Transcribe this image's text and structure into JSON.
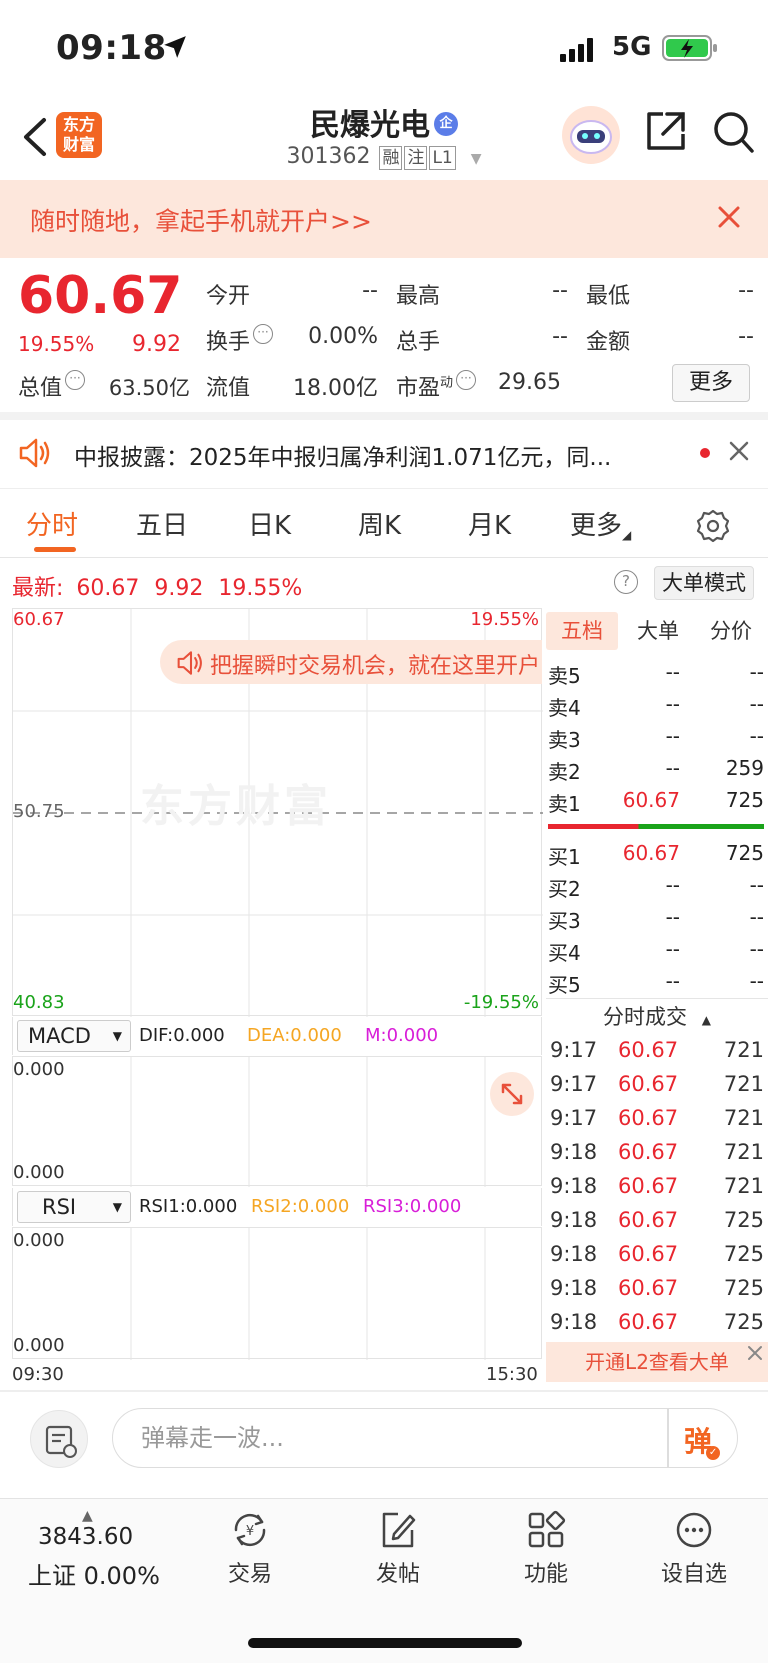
{
  "status_bar": {
    "time": "09:18",
    "network": "5G"
  },
  "header": {
    "logo_line1": "东方",
    "logo_line2": "财富",
    "stock_name": "民爆光电",
    "badge": "企",
    "stock_code": "301362",
    "tags": [
      "融",
      "注",
      "L1"
    ]
  },
  "banner": {
    "text": "随时随地，拿起手机就开户>>"
  },
  "quote": {
    "price": "60.67",
    "pct": "19.55%",
    "change": "9.92",
    "fields": [
      {
        "label": "今开",
        "value": "--"
      },
      {
        "label": "最高",
        "value": "--"
      },
      {
        "label": "最低",
        "value": "--"
      },
      {
        "label": "换手",
        "value": "0.00%"
      },
      {
        "label": "总手",
        "value": "--"
      },
      {
        "label": "金额",
        "value": "--"
      },
      {
        "label": "总值",
        "value": "63.50亿"
      },
      {
        "label": "流值",
        "value": "18.00亿"
      },
      {
        "label": "市盈",
        "sup": "动",
        "value": "29.65"
      }
    ],
    "more": "更多"
  },
  "notice": {
    "text": "中报披露：2025年中报归属净利润1.071亿元，同..."
  },
  "tabs": [
    "分时",
    "五日",
    "日K",
    "周K",
    "月K",
    "更多"
  ],
  "latest": {
    "label": "最新:",
    "price": "60.67",
    "change": "9.92",
    "pct": "19.55%"
  },
  "big_order_mode": "大单模式",
  "chart": {
    "price_high": "60.67",
    "pct_high": "19.55%",
    "price_mid": "50.75",
    "price_low": "40.83",
    "pct_low": "-19.55%",
    "watermark": "东方财富",
    "tip": "把握瞬时交易机会，就在这里开户",
    "time_start": "09:30",
    "time_end": "15:30"
  },
  "macd": {
    "name": "MACD",
    "dif": "DIF:0.000",
    "dea": "DEA:0.000",
    "m": "M:0.000",
    "top": "0.000",
    "bottom": "0.000",
    "colors": {
      "dif": "#222222",
      "dea": "#f5a623",
      "m": "#d81ed8"
    }
  },
  "rsi": {
    "name": "RSI",
    "rsi1": "RSI1:0.000",
    "rsi2": "RSI2:0.000",
    "rsi3": "RSI3:0.000",
    "top": "0.000",
    "bottom": "0.000"
  },
  "side_tabs": [
    "五档",
    "大单",
    "分价"
  ],
  "order_book": {
    "asks": [
      {
        "label": "卖5",
        "price": "--",
        "vol": "--"
      },
      {
        "label": "卖4",
        "price": "--",
        "vol": "--"
      },
      {
        "label": "卖3",
        "price": "--",
        "vol": "--"
      },
      {
        "label": "卖2",
        "price": "--",
        "vol": "259"
      },
      {
        "label": "卖1",
        "price": "60.67",
        "vol": "725"
      }
    ],
    "bids": [
      {
        "label": "买1",
        "price": "60.67",
        "vol": "725"
      },
      {
        "label": "买2",
        "price": "--",
        "vol": "--"
      },
      {
        "label": "买3",
        "price": "--",
        "vol": "--"
      },
      {
        "label": "买4",
        "price": "--",
        "vol": "--"
      },
      {
        "label": "买5",
        "price": "--",
        "vol": "--"
      }
    ]
  },
  "trades": {
    "title": "分时成交",
    "rows": [
      {
        "time": "9:17",
        "price": "60.67",
        "vol": "721"
      },
      {
        "time": "9:17",
        "price": "60.67",
        "vol": "721"
      },
      {
        "time": "9:17",
        "price": "60.67",
        "vol": "721"
      },
      {
        "time": "9:18",
        "price": "60.67",
        "vol": "721"
      },
      {
        "time": "9:18",
        "price": "60.67",
        "vol": "721"
      },
      {
        "time": "9:18",
        "price": "60.67",
        "vol": "725"
      },
      {
        "time": "9:18",
        "price": "60.67",
        "vol": "725"
      },
      {
        "time": "9:18",
        "price": "60.67",
        "vol": "725"
      },
      {
        "time": "9:18",
        "price": "60.67",
        "vol": "725"
      }
    ]
  },
  "l2_banner": "开通L2查看大单",
  "danmaku": {
    "placeholder": "弹幕走一波...",
    "send": "弹"
  },
  "bottom_nav": {
    "index_value": "3843.60",
    "index_name": "上证 0.00%",
    "items": [
      "交易",
      "发帖",
      "功能",
      "设自选"
    ]
  }
}
